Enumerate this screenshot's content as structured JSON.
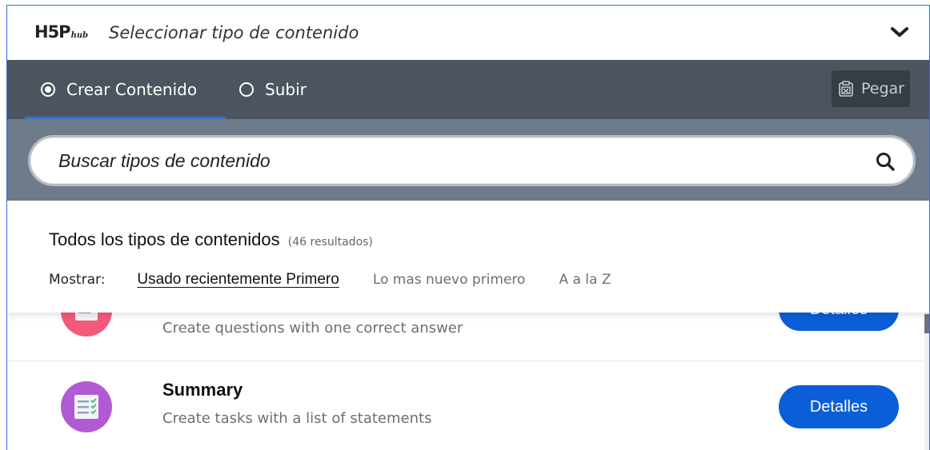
{
  "header": {
    "logo_text": "H5P",
    "logo_sub": "hub",
    "title": "Seleccionar tipo de contenido",
    "toggle_icon": "chevron-down-icon"
  },
  "tabs": [
    {
      "label": "Crear Contenido",
      "selected": true
    },
    {
      "label": "Subir",
      "selected": false
    }
  ],
  "paste": {
    "label": "Pegar",
    "icon": "clipboard-icon"
  },
  "search": {
    "placeholder": "Buscar tipos de contenido",
    "icon": "search-icon"
  },
  "results": {
    "title": "Todos los tipos de contenidos",
    "count": "(46 resultados)",
    "sort_label": "Mostrar:",
    "sort_options": [
      {
        "label": "Usado recientemente Primero",
        "active": true
      },
      {
        "label": "Lo mas nuevo primero",
        "active": false
      },
      {
        "label": "A a la Z",
        "active": false
      }
    ]
  },
  "items": [
    {
      "name": "",
      "description": "Create questions with one correct answer",
      "button": "Detalles",
      "icon_color": "#f25a7a"
    },
    {
      "name": "Summary",
      "description": "Create tasks with a list of statements",
      "button": "Detalles",
      "icon_color": "#b25ad4"
    }
  ],
  "colors": {
    "accent": "#0a5ed7",
    "tabbar": "#4c555f",
    "search_bg": "#6e7b8a"
  }
}
